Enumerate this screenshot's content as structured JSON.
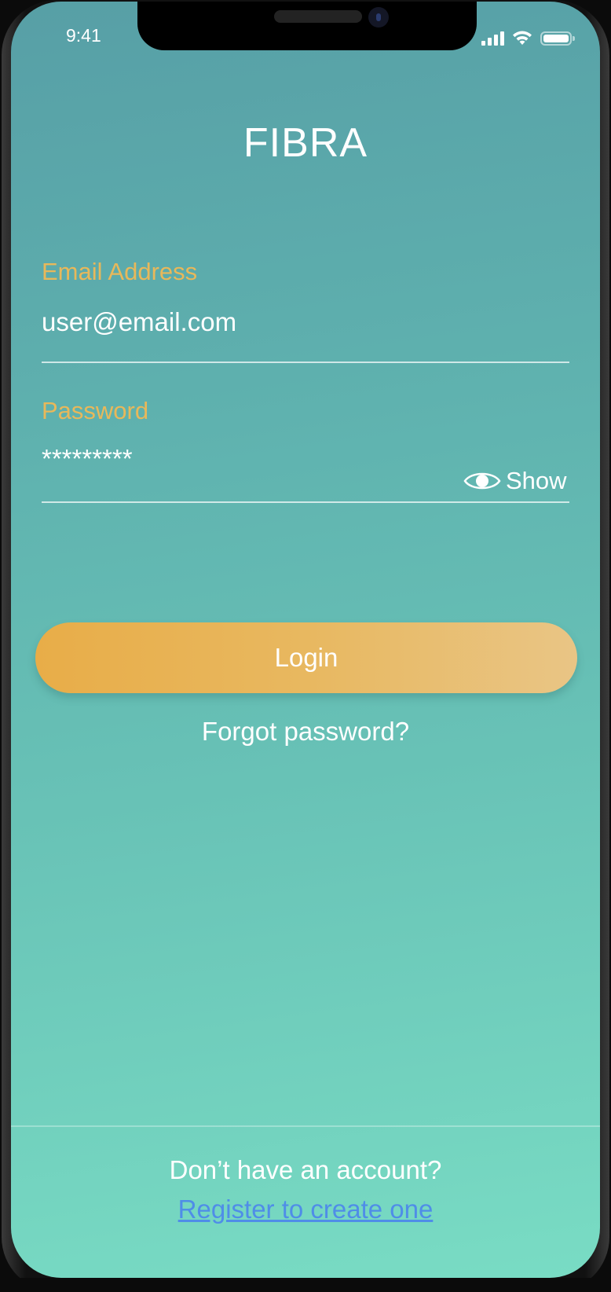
{
  "status_bar": {
    "time": "9:41",
    "icons": [
      "cellular-signal-icon",
      "wifi-icon",
      "battery-icon"
    ]
  },
  "app": {
    "title": "FIBRA"
  },
  "login_form": {
    "email_label": "Email Address",
    "email_value": "user@email.com",
    "password_label": "Password",
    "password_value": "*********",
    "show_label": "Show",
    "show_icon": "eye-icon",
    "login_label": "Login",
    "forgot_label": "Forgot password?"
  },
  "footer": {
    "prompt": "Don’t have an account?",
    "register_label": "Register to create one"
  },
  "colors": {
    "background_top": "#579fa6",
    "background_bottom": "#79dcc4",
    "label_accent": "#e8b85a",
    "button_start": "#e8ad48",
    "button_end": "#e9c585",
    "link": "#4f8de8"
  }
}
